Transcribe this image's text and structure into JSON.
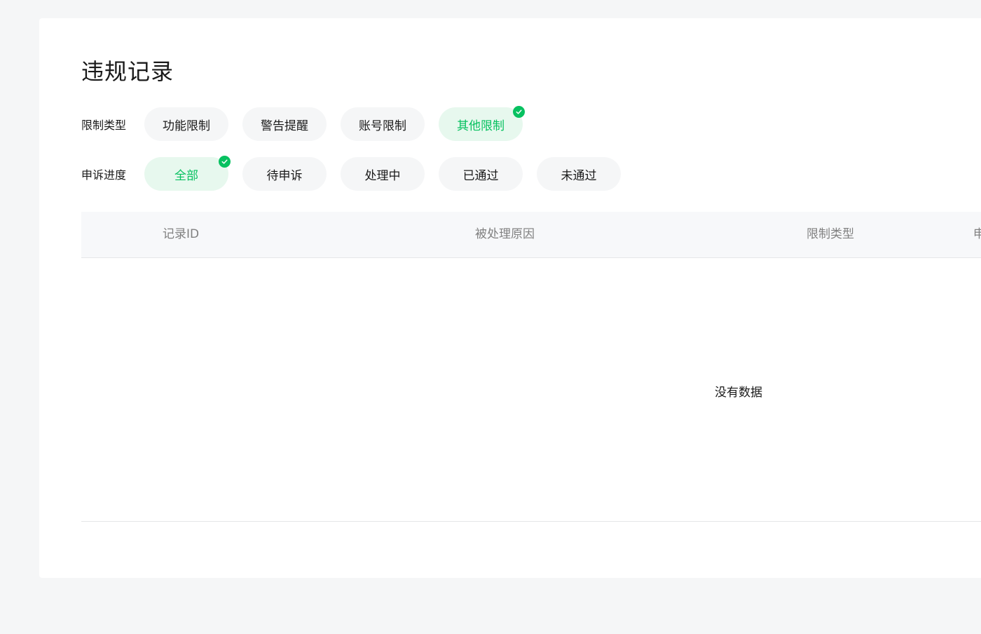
{
  "page": {
    "title": "违规记录"
  },
  "filters": {
    "restriction_type": {
      "label": "限制类型",
      "options": [
        {
          "label": "功能限制",
          "selected": false
        },
        {
          "label": "警告提醒",
          "selected": false
        },
        {
          "label": "账号限制",
          "selected": false
        },
        {
          "label": "其他限制",
          "selected": true
        }
      ]
    },
    "appeal_progress": {
      "label": "申诉进度",
      "options": [
        {
          "label": "全部",
          "selected": true
        },
        {
          "label": "待申诉",
          "selected": false
        },
        {
          "label": "处理中",
          "selected": false
        },
        {
          "label": "已通过",
          "selected": false
        },
        {
          "label": "未通过",
          "selected": false
        }
      ]
    }
  },
  "table": {
    "columns": [
      "记录ID",
      "被处理原因",
      "限制类型",
      "申"
    ],
    "rows": [],
    "empty_text": "没有数据"
  },
  "colors": {
    "accent": "#07c160",
    "selected_bg": "#e7f8ee",
    "chip_bg": "#f5f6f7",
    "page_bg": "#f5f6f7",
    "header_text": "#808080"
  },
  "icons": {
    "selected_badge": "check-circle-icon"
  }
}
